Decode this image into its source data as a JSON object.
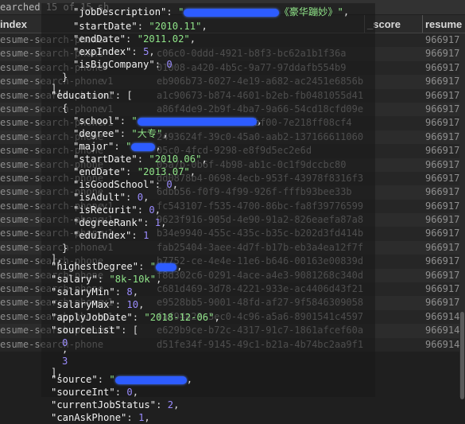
{
  "search_status": "earched 15 of 15 sh",
  "table": {
    "headers": [
      "index",
      "_score",
      "resume"
    ],
    "rows": [
      {
        "index": "esume-search-phone",
        "type": "",
        "id": "",
        "resume": "966917"
      },
      {
        "index": "esume-search-phone",
        "type": "",
        "id": "c06c0-0ddd-4921-b8f3-bc62a1b1f36a",
        "resume": "966917"
      },
      {
        "index": "esume-search-phone",
        "type": "",
        "id": "01008-a420-4b5c-9a77-97ddafb554b9",
        "resume": "966917"
      },
      {
        "index": "esume-search-phone",
        "type": "v1",
        "id": "eb906b73-6027-4e19-a682-ac2451e6856b",
        "resume": "966917"
      },
      {
        "index": "esume-search-phone",
        "type": "v1",
        "id": "a1c90673-b874-4601-b2eb-fb0481055d41",
        "resume": "966917"
      },
      {
        "index": "esume-search-phone",
        "type": "v1",
        "id": "a86f4de9-2b9f-4ba7-9a66-54cd18cfd09e",
        "resume": "966917"
      },
      {
        "index": "esume-search-phone",
        "type": "v1",
        "id": "2111d5-37f1-4546-bf00-7e218ff08cf4",
        "resume": "966917"
      },
      {
        "index": "esume-search-phone",
        "type": "",
        "id": "2493624f-39c0-45a0-aab2-137166611060",
        "resume": "966917"
      },
      {
        "index": "esume-search-phone",
        "type": "",
        "id": "05c0-4fcd-9298-e8f9d5ec2e6d",
        "resume": "966917"
      },
      {
        "index": "esume-search-phone",
        "type": "",
        "id": "05a7b-0b6f-4b98-ab1c-0c1f9dccbc80",
        "resume": "966917"
      },
      {
        "index": "esume-search-phone",
        "type": "",
        "id": "dd0878b4-0698-4ecb-953f-43978f8316f3",
        "resume": "966917"
      },
      {
        "index": "esume-search-phone",
        "type": "",
        "id": "6dbb56-f0f9-4f99-926f-fffb93bee33b",
        "resume": "966917"
      },
      {
        "index": "esume-search-phone",
        "type": "v1",
        "id": "fc543107-f535-4700-86bc-fa8f39776599",
        "resume": "966917"
      },
      {
        "index": "esume-search-phone",
        "type": "v1",
        "id": "9623f916-905d-4e90-91a2-826eaefa87a8",
        "resume": "966917"
      },
      {
        "index": "esume-search-phone",
        "type": "v1",
        "id": "b34e9940-455c-435c-b35c-b202d3fd414b",
        "resume": "966917"
      },
      {
        "index": "esume-search-phone",
        "type": "v1",
        "id": "fab25404-3aee-4d7f-b17b-eb3a4ea12f7f",
        "resume": "966917"
      },
      {
        "index": "esume-search-phone",
        "type": "",
        "id": "b7752-ce-4e4e-11e6-b646-00163e00839d",
        "resume": "966917"
      },
      {
        "index": "esume-search-phone",
        "type": "",
        "id": "f8d302c6-0291-4ace-a4e3-9081268c340d",
        "resume": "966917"
      },
      {
        "index": "esume-search-phone",
        "type": "",
        "id": "c681d469-3d78-4221-933e-ac4406d43f21",
        "resume": "966917"
      },
      {
        "index": "esume-search-phone",
        "type": "v1",
        "id": "e9528bb5-9001-48fd-af27-9f5846309058",
        "resume": "966917"
      },
      {
        "index": "esume-search-phone",
        "type": "v1",
        "id": "faf94a23-3ec0-4c96-a5a6-8901541c4597",
        "resume": "966914"
      },
      {
        "index": "esume-search-phone",
        "type": "v1",
        "id": "e629b9ce-b72c-4317-91c7-1861afcef60a",
        "resume": "966914"
      },
      {
        "index": "esume-search-phone",
        "type": "",
        "id": "d51fe34f-9145-49c1-b21a-4b74bc2aa9f1",
        "resume": "966914"
      }
    ]
  },
  "json_lines": [
    {
      "parts": [
        {
          "t": "\"jobDescription\"",
          "c": "k"
        },
        {
          "t": ": ",
          "c": "p"
        },
        {
          "t": "\"",
          "c": "s"
        },
        {
          "redact": 120
        },
        {
          "t": "《豪华蹦妙》\"",
          "c": "s"
        },
        {
          "t": ",",
          "c": "p"
        }
      ]
    },
    {
      "parts": [
        {
          "t": "\"startDate\"",
          "c": "k"
        },
        {
          "t": ": ",
          "c": "p"
        },
        {
          "t": "\"2010.11\"",
          "c": "s"
        },
        {
          "t": ",",
          "c": "p"
        }
      ]
    },
    {
      "parts": [
        {
          "t": "\"endDate\"",
          "c": "k"
        },
        {
          "t": ": ",
          "c": "p"
        },
        {
          "t": "\"2011.02\"",
          "c": "s"
        },
        {
          "t": ",",
          "c": "p"
        }
      ]
    },
    {
      "parts": [
        {
          "t": "\"expIndex\"",
          "c": "k"
        },
        {
          "t": ": ",
          "c": "p"
        },
        {
          "t": "5",
          "c": "n"
        },
        {
          "t": ",",
          "c": "p"
        }
      ]
    },
    {
      "parts": [
        {
          "t": "\"isBigCompany\"",
          "c": "k"
        },
        {
          "t": ": ",
          "c": "p"
        },
        {
          "t": "0",
          "c": "n"
        }
      ]
    },
    {
      "parts": [
        {
          "t": "}",
          "c": "p"
        }
      ]
    },
    {
      "parts": [
        {
          "t": "],",
          "c": "p"
        }
      ]
    },
    {
      "parts": [
        {
          "t": "\"education\"",
          "c": "k"
        },
        {
          "t": ": [",
          "c": "p"
        }
      ]
    },
    {
      "parts": [
        {
          "t": "{",
          "c": "p"
        }
      ]
    },
    {
      "parts": [
        {
          "t": "\"school\"",
          "c": "k"
        },
        {
          "t": ": ",
          "c": "p"
        },
        {
          "t": "\"",
          "c": "s"
        },
        {
          "redact": 150
        },
        {
          "t": ",",
          "c": "p"
        }
      ]
    },
    {
      "parts": [
        {
          "t": "\"degree\"",
          "c": "k"
        },
        {
          "t": ": ",
          "c": "p"
        },
        {
          "t": "\"大专\"",
          "c": "s"
        },
        {
          "t": ",",
          "c": "p"
        }
      ]
    },
    {
      "parts": [
        {
          "t": "\"major\"",
          "c": "k"
        },
        {
          "t": ": ",
          "c": "p"
        },
        {
          "t": "\"",
          "c": "s"
        },
        {
          "redact": 30
        },
        {
          "t": ",",
          "c": "p"
        }
      ]
    },
    {
      "parts": [
        {
          "t": "\"startDate\"",
          "c": "k"
        },
        {
          "t": ": ",
          "c": "p"
        },
        {
          "t": "\"2010.06\"",
          "c": "s"
        },
        {
          "t": ",",
          "c": "p"
        }
      ]
    },
    {
      "parts": [
        {
          "t": "\"endDate\"",
          "c": "k"
        },
        {
          "t": ": ",
          "c": "p"
        },
        {
          "t": "\"2013.07\"",
          "c": "s"
        },
        {
          "t": ",",
          "c": "p"
        }
      ]
    },
    {
      "parts": [
        {
          "t": "\"isGoodSchool\"",
          "c": "k"
        },
        {
          "t": ": ",
          "c": "p"
        },
        {
          "t": "0",
          "c": "n"
        },
        {
          "t": ",",
          "c": "p"
        }
      ]
    },
    {
      "parts": [
        {
          "t": "\"isAdult\"",
          "c": "k"
        },
        {
          "t": ": ",
          "c": "p"
        },
        {
          "t": "0",
          "c": "n"
        },
        {
          "t": ",",
          "c": "p"
        }
      ]
    },
    {
      "parts": [
        {
          "t": "\"isRecurit\"",
          "c": "k"
        },
        {
          "t": ": ",
          "c": "p"
        },
        {
          "t": "0",
          "c": "n"
        },
        {
          "t": ",",
          "c": "p"
        }
      ]
    },
    {
      "parts": [
        {
          "t": "\"degreeRank\"",
          "c": "k"
        },
        {
          "t": ": ",
          "c": "p"
        },
        {
          "t": "1",
          "c": "n"
        },
        {
          "t": ",",
          "c": "p"
        }
      ]
    },
    {
      "parts": [
        {
          "t": "\"eduIndex\"",
          "c": "k"
        },
        {
          "t": ": ",
          "c": "p"
        },
        {
          "t": "1",
          "c": "n"
        }
      ]
    },
    {
      "parts": [
        {
          "t": "}",
          "c": "p"
        }
      ]
    },
    {
      "parts": [
        {
          "t": "],",
          "c": "p"
        }
      ]
    },
    {
      "parts": [
        {
          "t": "\"highestDegree\"",
          "c": "k"
        },
        {
          "t": ": ",
          "c": "p"
        },
        {
          "t": "\"",
          "c": "s"
        },
        {
          "redact": 26
        },
        {
          "t": ",",
          "c": "p"
        }
      ]
    },
    {
      "parts": [
        {
          "t": "\"salary\"",
          "c": "k"
        },
        {
          "t": ": ",
          "c": "p"
        },
        {
          "t": "\"8k-10k\"",
          "c": "s"
        },
        {
          "t": ",",
          "c": "p"
        }
      ]
    },
    {
      "parts": [
        {
          "t": "\"salaryMin\"",
          "c": "k"
        },
        {
          "t": ": ",
          "c": "p"
        },
        {
          "t": "8",
          "c": "n"
        },
        {
          "t": ",",
          "c": "p"
        }
      ]
    },
    {
      "parts": [
        {
          "t": "\"salaryMax\"",
          "c": "k"
        },
        {
          "t": ": ",
          "c": "p"
        },
        {
          "t": "10",
          "c": "n"
        },
        {
          "t": ",",
          "c": "p"
        }
      ]
    },
    {
      "parts": [
        {
          "t": "\"applyJobDate\"",
          "c": "k"
        },
        {
          "t": ": ",
          "c": "p"
        },
        {
          "t": "\"2018-12-06\"",
          "c": "s"
        },
        {
          "t": ",",
          "c": "p"
        }
      ]
    },
    {
      "parts": [
        {
          "t": "\"sourceList\"",
          "c": "k"
        },
        {
          "t": ": [",
          "c": "p"
        }
      ]
    },
    {
      "parts": [
        {
          "t": "0",
          "c": "n"
        }
      ]
    },
    {
      "parts": [
        {
          "t": ",",
          "c": "p"
        }
      ]
    },
    {
      "parts": [
        {
          "t": "3",
          "c": "n"
        }
      ]
    },
    {
      "parts": [
        {
          "t": "],",
          "c": "p"
        }
      ]
    },
    {
      "parts": [
        {
          "t": "\"source\"",
          "c": "k"
        },
        {
          "t": ": ",
          "c": "p"
        },
        {
          "t": "\"",
          "c": "s"
        },
        {
          "redact": 90
        },
        {
          "t": ",",
          "c": "p"
        }
      ]
    },
    {
      "parts": [
        {
          "t": "\"sourceInt\"",
          "c": "k"
        },
        {
          "t": ": ",
          "c": "p"
        },
        {
          "t": "0",
          "c": "n"
        },
        {
          "t": ",",
          "c": "p"
        }
      ]
    },
    {
      "parts": [
        {
          "t": "\"currentJobStatus\"",
          "c": "k"
        },
        {
          "t": ": ",
          "c": "p"
        },
        {
          "t": "2",
          "c": "n"
        },
        {
          "t": ",",
          "c": "p"
        }
      ]
    },
    {
      "parts": [
        {
          "t": "\"canAskPhone\"",
          "c": "k"
        },
        {
          "t": ": ",
          "c": "p"
        },
        {
          "t": "1",
          "c": "n"
        },
        {
          "t": ",",
          "c": "p"
        }
      ]
    }
  ]
}
